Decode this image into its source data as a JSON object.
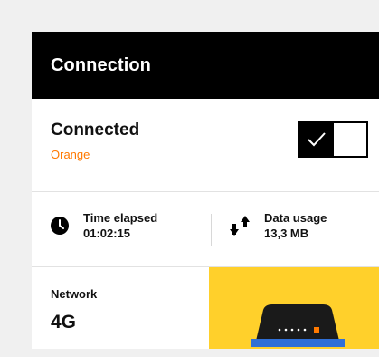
{
  "header": {
    "title": "Connection"
  },
  "connection": {
    "status": "Connected",
    "operator": "Orange",
    "toggle_on": true
  },
  "stats": {
    "time_label": "Time elapsed",
    "time_value": "01:02:15",
    "data_label": "Data usage",
    "data_value": "13,3 MB"
  },
  "network": {
    "label": "Network",
    "value": "4G"
  },
  "icons": {
    "time": "clock-icon",
    "data": "arrows-up-down-icon",
    "toggle": "check-icon",
    "router": "router-icon"
  },
  "colors": {
    "header_bg": "#000000",
    "accent_orange": "#ff7900",
    "panel_yellow": "#ffd02b",
    "router_blue": "#2f6fd6"
  }
}
